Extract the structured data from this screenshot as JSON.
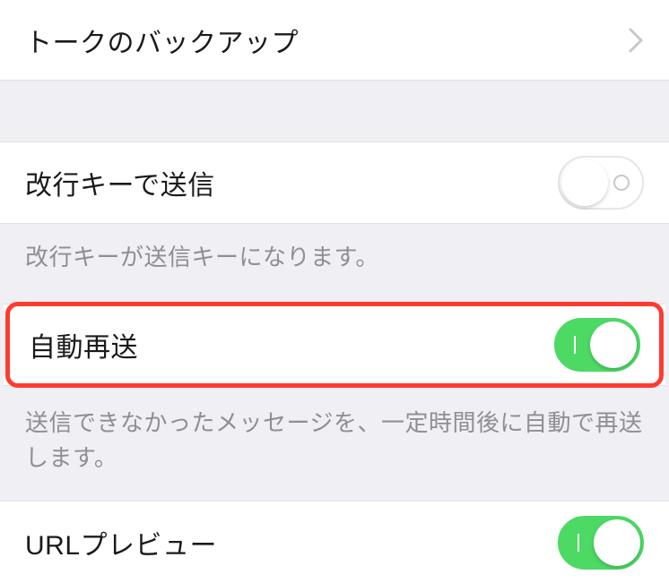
{
  "sections": {
    "backup": {
      "label": "トークのバックアップ"
    },
    "enterSend": {
      "label": "改行キーで送信",
      "desc": "改行キーが送信キーになります。"
    },
    "autoResend": {
      "label": "自動再送",
      "desc": "送信できなかったメッセージを、一定時間後に自動で再送します。"
    },
    "urlPreview": {
      "label": "URLプレビュー"
    }
  }
}
